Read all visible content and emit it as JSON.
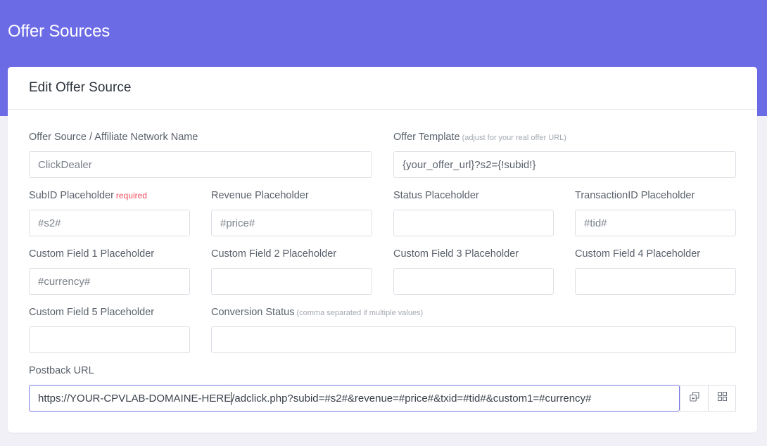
{
  "header": {
    "title": "Offer Sources"
  },
  "card": {
    "title": "Edit Offer Source"
  },
  "form": {
    "name": {
      "label": "Offer Source / Affiliate Network Name",
      "value": "ClickDealer"
    },
    "template": {
      "label": "Offer Template",
      "hint": "(adjust for your real offer URL)",
      "value": "{your_offer_url}?s2={!subid!}"
    },
    "subid": {
      "label": "SubID Placeholder",
      "required": "required",
      "value": "#s2#"
    },
    "revenue": {
      "label": "Revenue Placeholder",
      "value": "#price#"
    },
    "status": {
      "label": "Status Placeholder",
      "value": ""
    },
    "transaction": {
      "label": "TransactionID Placeholder",
      "value": "#tid#"
    },
    "custom1": {
      "label": "Custom Field 1 Placeholder",
      "value": "#currency#"
    },
    "custom2": {
      "label": "Custom Field 2 Placeholder",
      "value": ""
    },
    "custom3": {
      "label": "Custom Field 3 Placeholder",
      "value": ""
    },
    "custom4": {
      "label": "Custom Field 4 Placeholder",
      "value": ""
    },
    "custom5": {
      "label": "Custom Field 5 Placeholder",
      "value": ""
    },
    "conversion": {
      "label": "Conversion Status",
      "hint": "(comma separated if multiple values)",
      "value": ""
    },
    "postback": {
      "label": "Postback URL",
      "value_before_caret": "https://YOUR-CPVLAB-DOMAINE-HERE",
      "value_after_caret": "/adclick.php?subid=#s2#&revenue=#price#&txid=#tid#&custom1=#currency#"
    }
  },
  "icons": {
    "copy": "copy-icon",
    "qr": "qr-code-icon"
  },
  "colors": {
    "banner": "#6c6be6",
    "required": "#ef4a5a",
    "focus_border": "#7a79e6"
  }
}
